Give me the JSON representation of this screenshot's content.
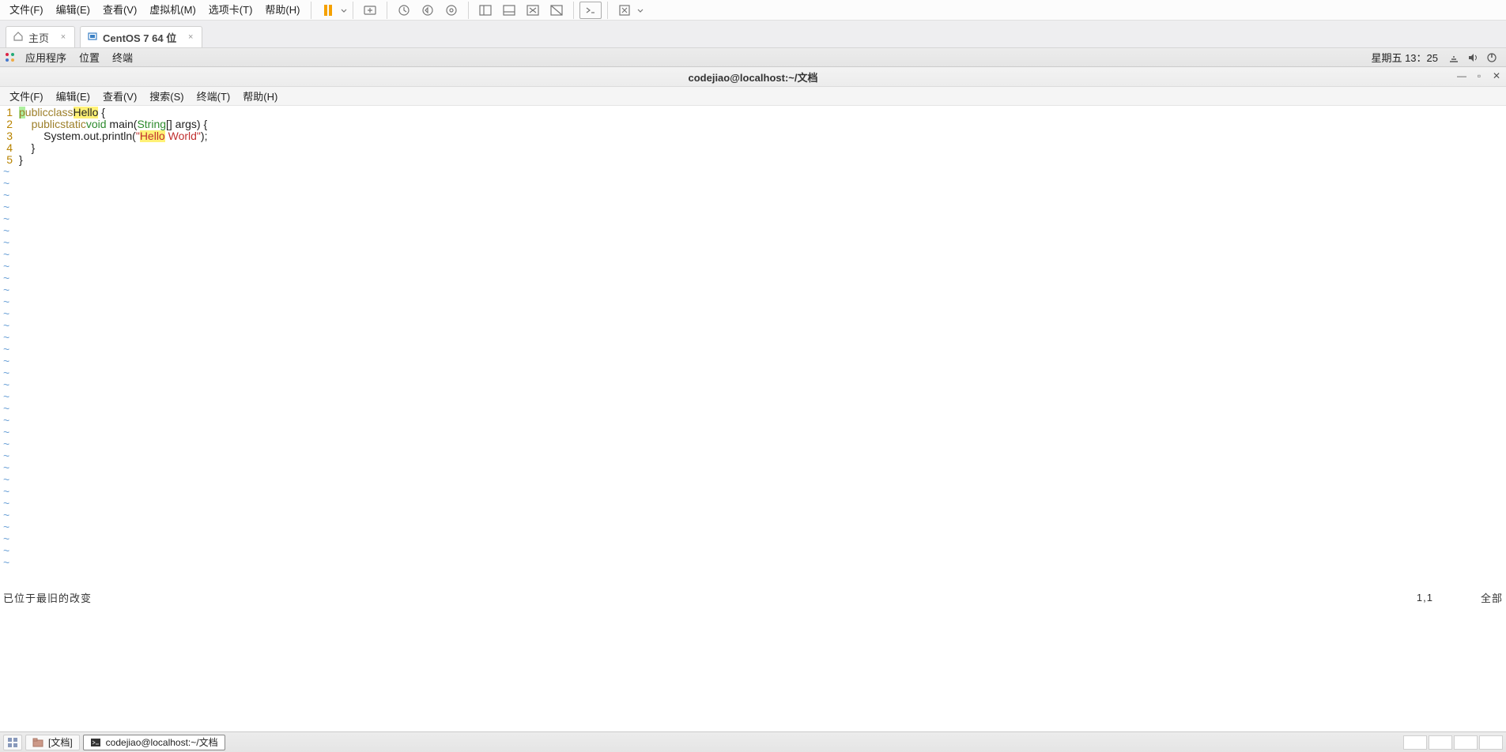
{
  "vmware_menu": {
    "items": [
      "文件(F)",
      "编辑(E)",
      "查看(V)",
      "虚拟机(M)",
      "选项卡(T)",
      "帮助(H)"
    ]
  },
  "tabs": {
    "home": "主页",
    "vm": "CentOS 7 64 位"
  },
  "gnome_top": {
    "apps": "应用程序",
    "places": "位置",
    "terminal": "终端",
    "clock": "星期五 13：25"
  },
  "terminal_title": "codejiao@localhost:~/文档",
  "terminal_menu": [
    "文件(F)",
    "编辑(E)",
    "查看(V)",
    "搜索(S)",
    "终端(T)",
    "帮助(H)"
  ],
  "code": {
    "l1_public": "public",
    "l1_class": "class",
    "l1_hello": "Hello",
    "l1_rest": " {",
    "l2_indent": "    ",
    "l2_public": "public",
    "l2_static": "static",
    "l2_void": "void",
    "l2_main": " main(",
    "l2_string": "String",
    "l2_rest": "[] args) {",
    "l3_indent": "        System.out.println(",
    "l3_q1": "\"",
    "l3_h": "Hello",
    "l3_w": " World",
    "l3_q2": "\"",
    "l3_end": ");",
    "l4": "    }",
    "l5": "}"
  },
  "lines": [
    "1",
    "2",
    "3",
    "4",
    "5"
  ],
  "tildes": 34,
  "vim_status": {
    "msg": "已位于最旧的改变",
    "pos": "1,1",
    "mode": "全部"
  },
  "tasks": {
    "docs": "[文档]",
    "term": "codejiao@localhost:~/文档"
  }
}
